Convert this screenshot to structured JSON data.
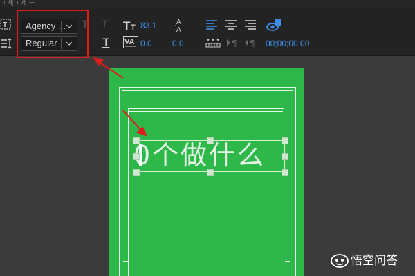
{
  "title_strip": {
    "text": "ㄱ 세ㄱ 세 ㅡ"
  },
  "toolbar": {
    "font_family": "Agency ...",
    "font_style": "Regular",
    "font_size": "83.1",
    "tracking": "0.0",
    "leading": "0.0",
    "timecode": "00;00;00;00",
    "icons": {
      "text_tool": "text-box-icon",
      "text_vertical": "vertical-text-icon",
      "faux_bold": "T",
      "faux_italic": "T",
      "underline": "T",
      "font_size_icon": "font-size-icon",
      "kerning_icon": "kerning-icon",
      "leading_icon": "leading-icon",
      "align_left": "align-left-icon",
      "align_center": "align-center-icon",
      "align_right": "align-right-icon",
      "tab_stops": "tab-stops-icon",
      "indent_left": "indent-left-icon",
      "indent_right": "indent-right-icon",
      "show_video": "show-video-icon"
    }
  },
  "canvas": {
    "text_content": "0个做什么",
    "background_color": "#2eb84a"
  },
  "watermark": {
    "text": "悟空问答"
  },
  "colors": {
    "accent_blue": "#3d8ee8",
    "highlight_red": "#e01b1b"
  }
}
